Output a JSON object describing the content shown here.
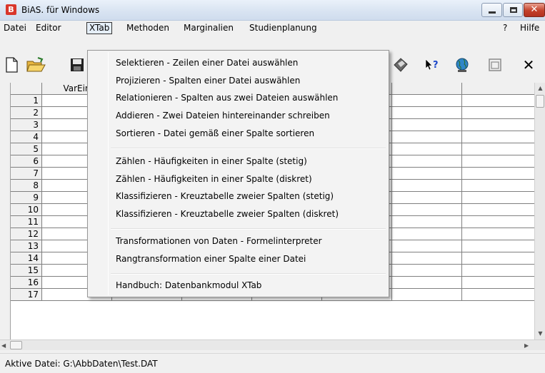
{
  "window": {
    "title": "BiAS. für Windows",
    "app_icon_glyph": "B"
  },
  "caption_buttons": {
    "close_glyph": "✕"
  },
  "menubar": {
    "items": [
      "Datei",
      "Editor",
      "XTab",
      "Methoden",
      "Marginalien",
      "Studienplanung"
    ],
    "help_question": "?",
    "help_label": "Hilfe"
  },
  "toolbar": {
    "icons": [
      "new-file-icon",
      "open-folder-icon",
      "save-disk-icon",
      "book-icon",
      "context-help-icon",
      "globe-icon",
      "window-icon",
      "close-icon"
    ],
    "close_glyph": "✕"
  },
  "grid": {
    "first_column_header": "VarEin",
    "row_numbers": [
      "1",
      "2",
      "3",
      "4",
      "5",
      "6",
      "7",
      "8",
      "9",
      "10",
      "11",
      "12",
      "13",
      "14",
      "15",
      "16",
      "17"
    ]
  },
  "xtab_menu": {
    "items": [
      "Selektieren - Zeilen einer Datei auswählen",
      "Projizieren - Spalten einer Datei auswählen",
      "Relationieren - Spalten aus zwei Dateien auswählen",
      "Addieren - Zwei Dateien hintereinander schreiben",
      "Sortieren - Datei gemäß einer Spalte sortieren",
      "Zählen - Häufigkeiten in einer Spalte (stetig)",
      "Zählen - Häufigkeiten in einer Spalte (diskret)",
      "Klassifizieren - Kreuztabelle zweier Spalten (stetig)",
      "Klassifizieren - Kreuztabelle zweier Spalten (diskret)",
      "Transformationen von Daten - Formelinterpreter",
      "Rangtransformation einer Spalte einer Datei",
      "Handbuch: Datenbankmodul XTab"
    ]
  },
  "statusbar": {
    "text": "Aktive Datei: G:\\AbbDaten\\Test.DAT"
  },
  "colors": {
    "title_bar": "#dbe6f4",
    "close_button": "#c3402a",
    "app_icon": "#d9362b"
  }
}
